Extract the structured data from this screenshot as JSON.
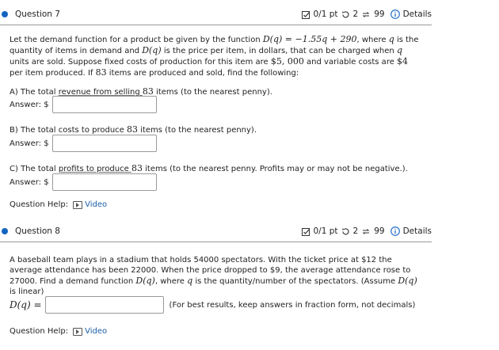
{
  "q7": {
    "title": "Question 7",
    "score": "0/1 pt",
    "tries": "2",
    "attempts": "99",
    "details": "Details",
    "intro": {
      "t1": "Let the demand function for a product be given by the function ",
      "m1": "D(q) = −1.55q + 290",
      "t2": ", where ",
      "m2": "q",
      "t3": " is the quantity of items in demand and ",
      "m3": "D(q)",
      "t4": " is the price per item, in dollars, that can be charged when ",
      "m4": "q",
      "t5": " units are sold. Suppose fixed costs of production for this item are ",
      "m5": "$5, 000",
      "t6": " and variable costs are ",
      "m6": "$4",
      "t7": " per item produced. If ",
      "m7": "83",
      "t8": " items are produced and sold, find the following:"
    },
    "partA": {
      "pre": "A) The total ",
      "ul": "revenue from selling ",
      "num": "83",
      "post": " items (to the nearest penny)."
    },
    "partB": {
      "pre": "B) The total costs to produce ",
      "num": "83",
      "post": " items (to the nearest penny)."
    },
    "partC": {
      "pre": "C) The total ",
      "ul": "profits to produce ",
      "num": "83",
      "post": " items (to the nearest penny. Profits may or may not be negative.)."
    },
    "answer_label": "Answer: $",
    "help_label": "Question Help:",
    "video_label": "Video"
  },
  "q8": {
    "title": "Question 8",
    "score": "0/1 pt",
    "tries": "2",
    "attempts": "99",
    "details": "Details",
    "intro": {
      "t1": "A baseball team plays in a stadium that holds 54000 spectators. With the ticket price at $12 the average attendance has been 22000. When the price dropped to $9, the average attendance rose to 27000. Find a demand function ",
      "m1": "D(q)",
      "t2": ", where ",
      "m2": "q",
      "t3": " is the quantity/number of the spectators. (Assume ",
      "m3": "D(q)",
      "t4": " is linear)"
    },
    "func_label": "D(q) =",
    "hint": "(For best results, keep answers in fraction form, not decimals)",
    "help_label": "Question Help:",
    "video_label": "Video"
  },
  "colors": {
    "accent": "#1565c0",
    "link": "#1a5dab",
    "rule": "#9a9a9a"
  }
}
